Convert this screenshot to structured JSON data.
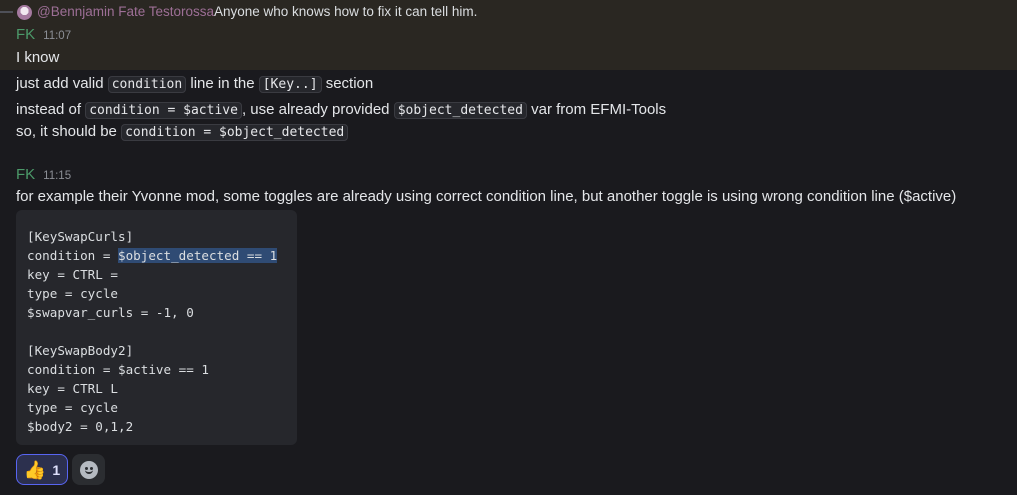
{
  "reply": {
    "mention": "@Bennjamin Fate Testorossa",
    "text": "Anyone who knows how to fix it can tell him."
  },
  "message1": {
    "author": "FK",
    "time": "11:07",
    "text": "I know"
  },
  "message1_cont": {
    "line1_a": "just add valid ",
    "line1_code1": "condition",
    "line1_b": " line in the ",
    "line1_code2": "[Key..]",
    "line1_c": " section",
    "line2_a": "instead of ",
    "line2_code1": "condition = $active",
    "line2_b": ", use already provided ",
    "line2_code2": "$object_detected",
    "line2_c": " var from EFMI-Tools",
    "line3_a": "so, it should be ",
    "line3_code1": "condition = $object_detected"
  },
  "message2": {
    "author": "FK",
    "time": "11:15",
    "text": "for example their Yvonne mod, some toggles are already using correct condition line, but another toggle is using wrong condition line ($active)"
  },
  "code_block": {
    "l1": "[KeySwapCurls]",
    "l2_a": "condition = ",
    "l2_sel": "$object_detected == 1",
    "l3": "key = CTRL =",
    "l4": "type = cycle",
    "l5": "$swapvar_curls = -1, 0",
    "l6": "",
    "l7": "[KeySwapBody2]",
    "l8": "condition = $active == 1",
    "l9": "key = CTRL L",
    "l10": "type = cycle",
    "l11": "$body2 = 0,1,2"
  },
  "reactions": {
    "thumbs_up_emoji": "👍",
    "thumbs_up_count": "1",
    "add_reaction_icon": "smile-plus-icon"
  }
}
